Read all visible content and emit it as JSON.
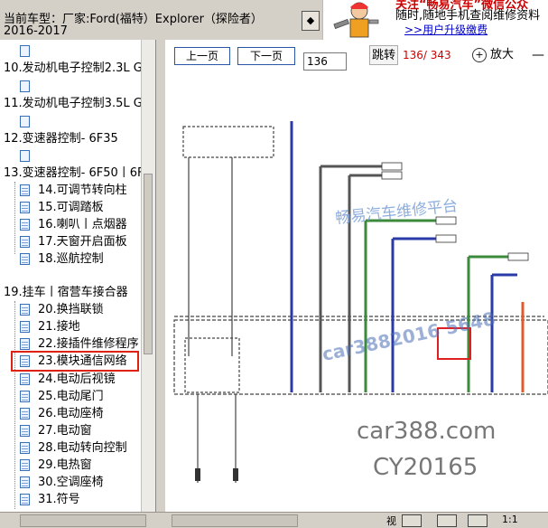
{
  "header": {
    "car_model_line1": "当前车型：厂家:Ford(福特）Explorer（探险者）",
    "car_model_line2": "2016-2017",
    "toolbar_button_glyph": "◆"
  },
  "ad_banner": {
    "line1": "关注“畅易汽车”微信公众",
    "line2": "随时,随地手机查阅维修资料",
    "link": ">>用户升级缴费"
  },
  "sidebar": {
    "items": [
      {
        "label": "10.发动机电子控制2.3L G"
      },
      {
        "label": "11.发动机电子控制3.5L G"
      },
      {
        "label": "12.变速器控制- 6F35"
      },
      {
        "label": "13.变速器控制- 6F50丨6F"
      },
      {
        "label": "14.可调节转向柱"
      },
      {
        "label": "15.可调踏板"
      },
      {
        "label": "16.喇叭丨点烟器"
      },
      {
        "label": "17.天窗开启面板"
      },
      {
        "label": "18.巡航控制"
      },
      {
        "label": "19.挂车丨宿营车接合器"
      },
      {
        "label": "20.换挡联锁"
      },
      {
        "label": "21.接地"
      },
      {
        "label": "22.接插件维修程序"
      },
      {
        "label": "23.模块通信网络"
      },
      {
        "label": "24.电动后视镜"
      },
      {
        "label": "25.电动尾门"
      },
      {
        "label": "26.电动座椅"
      },
      {
        "label": "27.电动窗"
      },
      {
        "label": "28.电动转向控制"
      },
      {
        "label": "29.电热窗"
      },
      {
        "label": "30.空调座椅"
      },
      {
        "label": "31.符号"
      }
    ]
  },
  "viewer": {
    "prev_page": "上一页",
    "next_page": "下一页",
    "page_input": "136",
    "jump": "跳转",
    "page_count": "136/ 343",
    "zoom_in": "放大",
    "zoom_out": "—"
  },
  "watermarks": {
    "brand": "畅易汽车维修平台",
    "phone": "car3882016 5648",
    "site": "car388.com",
    "code": "CY20165"
  },
  "statusbar": {
    "view_label": "视",
    "scale_label": "1:1"
  },
  "colors": {
    "selection_outline": "#d21",
    "page_count": "#c00",
    "link": "#0000cc",
    "wire_green": "#3c8a3c",
    "wire_blue": "#2a3aa8",
    "wire_orange": "#e05a2a"
  }
}
